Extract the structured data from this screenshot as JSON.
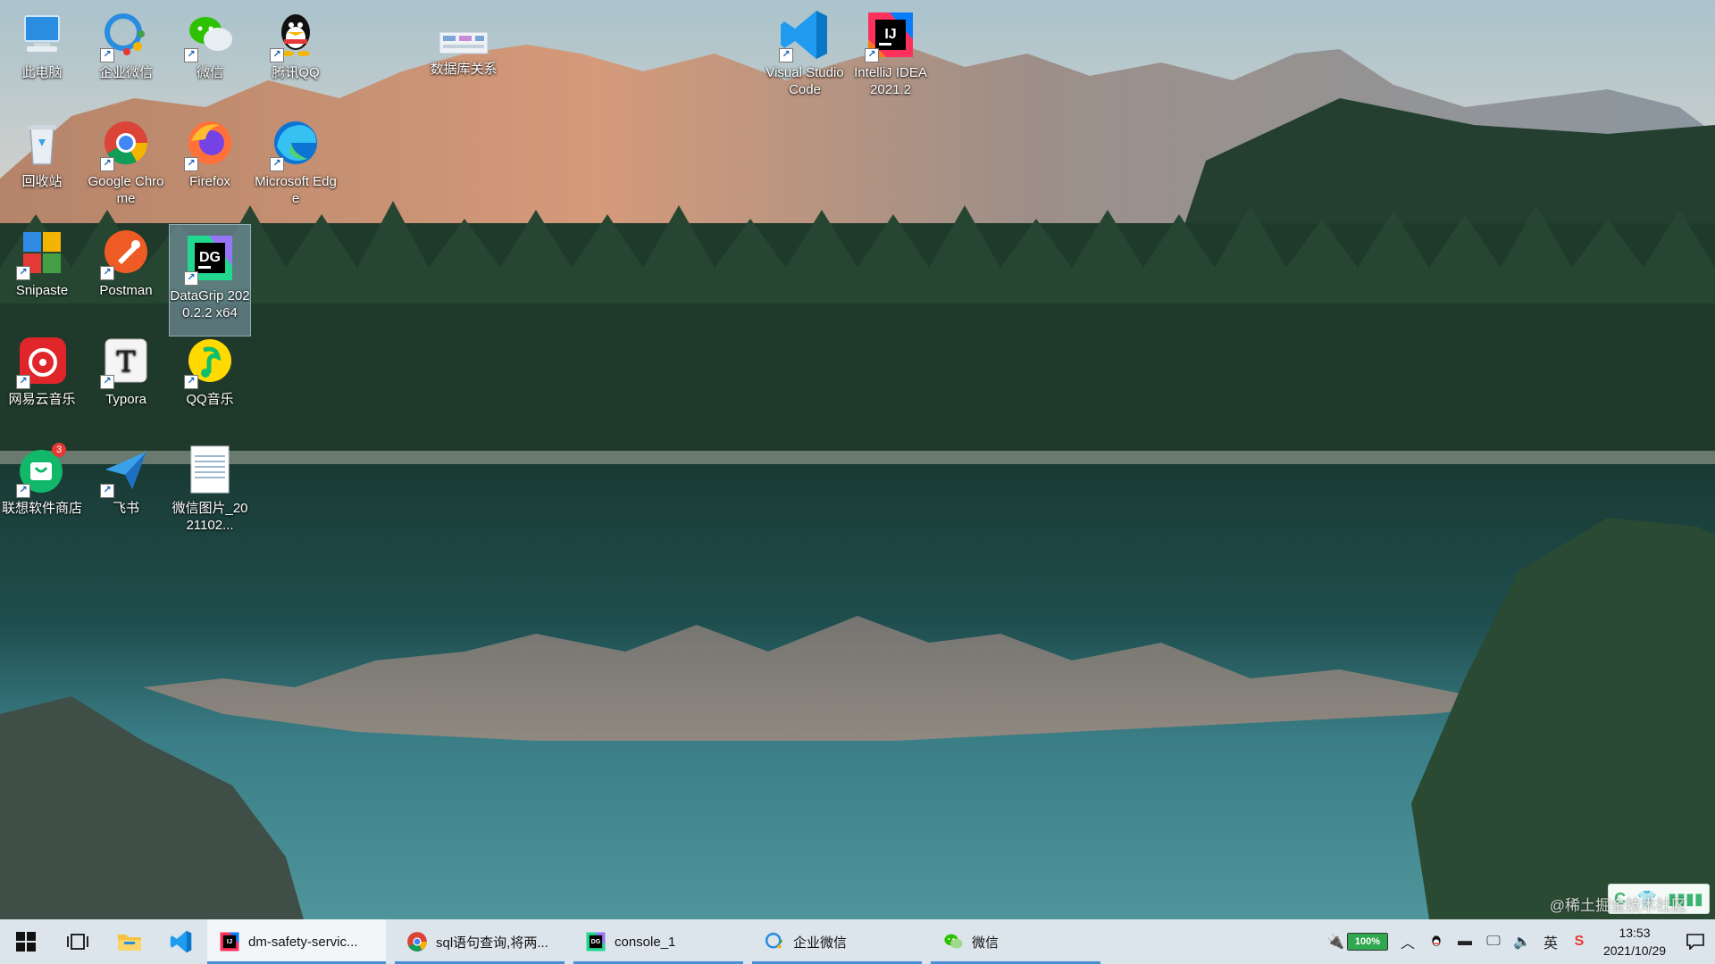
{
  "desktop": {
    "icons": [
      {
        "label": "此电脑",
        "icon": "computer-icon"
      },
      {
        "label": "企业微信",
        "icon": "wecom-icon"
      },
      {
        "label": "微信",
        "icon": "wechat-icon"
      },
      {
        "label": "腾讯QQ",
        "icon": "qq-icon"
      },
      {
        "label": "数据库关系",
        "icon": "database-relation-icon"
      },
      {
        "label": "Visual Studio Code",
        "icon": "vscode-icon"
      },
      {
        "label": "IntelliJ IDEA 2021.2",
        "icon": "intellij-icon"
      },
      {
        "label": "回收站",
        "icon": "recycle-bin-icon"
      },
      {
        "label": "Google Chrome",
        "icon": "chrome-icon"
      },
      {
        "label": "Firefox",
        "icon": "firefox-icon"
      },
      {
        "label": "Microsoft Edge",
        "icon": "edge-icon"
      },
      {
        "label": "Snipaste",
        "icon": "snipaste-icon"
      },
      {
        "label": "Postman",
        "icon": "postman-icon"
      },
      {
        "label": "DataGrip 2020.2.2 x64",
        "icon": "datagrip-icon"
      },
      {
        "label": "网易云音乐",
        "icon": "netease-music-icon"
      },
      {
        "label": "Typora",
        "icon": "typora-icon"
      },
      {
        "label": "QQ音乐",
        "icon": "qqmusic-icon"
      },
      {
        "label": "联想软件商店",
        "icon": "lenovo-store-icon",
        "badge": "3"
      },
      {
        "label": "飞书",
        "icon": "feishu-icon"
      },
      {
        "label": "微信图片_2021102...",
        "icon": "image-file-icon"
      }
    ],
    "watermark": "@稀土掘金技术社区"
  },
  "taskbar": {
    "apps": [
      {
        "label": "dm-safety-servic...",
        "icon": "intellij-icon"
      },
      {
        "label": "sql语句查询,将两...",
        "icon": "chrome-icon"
      },
      {
        "label": "console_1",
        "icon": "datagrip-icon"
      },
      {
        "label": "企业微信",
        "icon": "wecom-icon"
      },
      {
        "label": "微信",
        "icon": "wechat-icon"
      }
    ],
    "tray": {
      "battery_percent": "100%",
      "battery_level": 1.0,
      "ime": "英",
      "time": "13:53",
      "date": "2021/10/29"
    }
  },
  "colors": {
    "taskbar_bg": "#dde5ec",
    "accent": "#4b8fd6"
  }
}
